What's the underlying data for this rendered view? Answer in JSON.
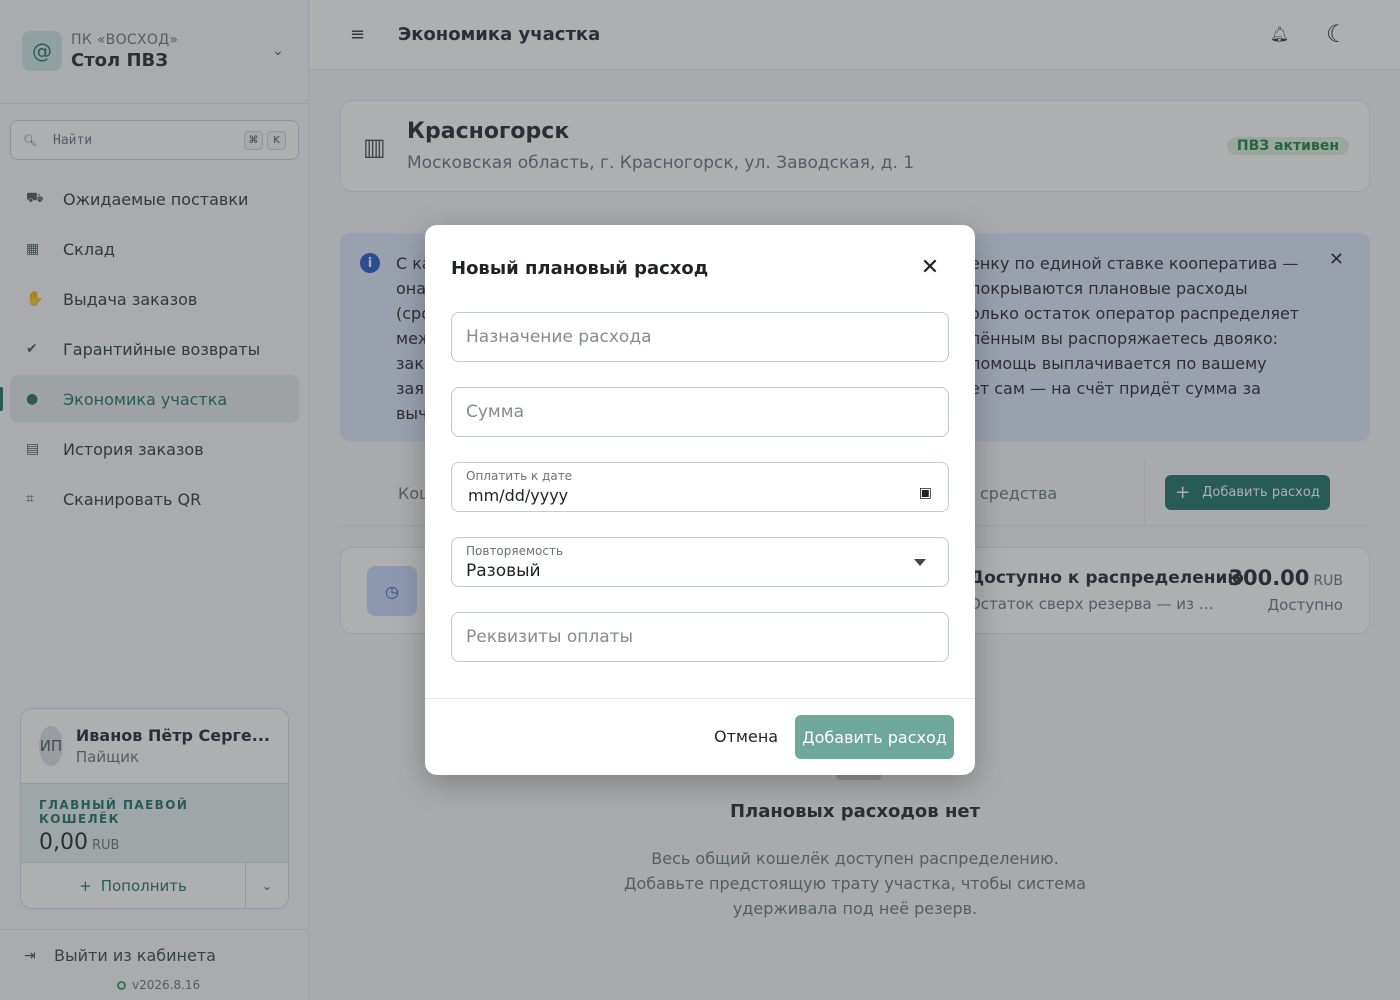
{
  "sidebar": {
    "org_sub": "ПК «ВОСХОД»",
    "org_name": "Стол ПВЗ",
    "search_placeholder": "Найти",
    "kbd1": "⌘",
    "kbd2": "K",
    "items": [
      {
        "label": "Ожидаемые поставки"
      },
      {
        "label": "Склад"
      },
      {
        "label": "Выдача заказов"
      },
      {
        "label": "Гарантийные возвраты"
      },
      {
        "label": "Экономика участка"
      },
      {
        "label": "История заказов"
      },
      {
        "label": "Сканировать QR"
      }
    ],
    "user": {
      "initials": "ИП",
      "name": "Иванов Пётр Серге...",
      "role": "Пайщик"
    },
    "wallet": {
      "label": "ГЛАВНЫЙ ПАЕВОЙ КОШЕЛЁК",
      "amount": "0,00",
      "currency": "RUB"
    },
    "topup_label": "Пополнить",
    "logout_label": "Выйти из кабинета",
    "version": "v2026.8.16"
  },
  "header": {
    "title": "Экономика участка"
  },
  "location": {
    "title": "Красногорск",
    "address": "Московская область, г. Красногорск, ул. Заводская, д. 1",
    "badge": "ПВЗ активен"
  },
  "info": {
    "left_lines": [
      "С ка",
      "она",
      "(сро",
      "меж",
      "зака",
      "заяв",
      "выч"
    ],
    "right_lines": [
      "енку по единой ставке кооператива —",
      "покрываются плановые расходы",
      "олько остаток оператор распределяет",
      "лённым вы распоряжаетесь двояко:",
      "помощь выплачивается по вашему",
      "ет сам — на счёт придёт сумма за"
    ]
  },
  "tabs": {
    "left": "Кош",
    "right": "средства",
    "add_button": "Добавить расход"
  },
  "available": {
    "title": "Доступно к распределению",
    "subtitle": "Остаток сверх резерва — из него...",
    "amount": "300.00",
    "currency": "RUB",
    "label": "Доступно"
  },
  "empty": {
    "title": "Плановых расходов нет",
    "text": "Весь общий кошелёк доступен распределению. Добавьте предстоящую трату участка, чтобы система удерживала под неё резерв."
  },
  "modal": {
    "title": "Новый плановый расход",
    "purpose_placeholder": "Назначение расхода",
    "amount_placeholder": "Сумма",
    "date_label": "Оплатить к дате",
    "date_value": "mm/dd/yyyy",
    "repeat_label": "Повторяемость",
    "repeat_value": "Разовый",
    "requisites_placeholder": "Реквизиты оплаты",
    "cancel": "Отмена",
    "submit": "Добавить расход"
  }
}
